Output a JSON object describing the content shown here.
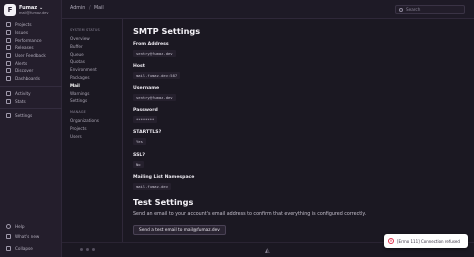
{
  "sidebar": {
    "org_initial": "F",
    "org_name": "Fumaz",
    "org_email": "mail@fumaz.dev",
    "items": [
      {
        "label": "Projects",
        "icon": "projects-icon"
      },
      {
        "label": "Issues",
        "icon": "issues-icon"
      },
      {
        "label": "Performance",
        "icon": "performance-icon"
      },
      {
        "label": "Releases",
        "icon": "releases-icon"
      },
      {
        "label": "User Feedback",
        "icon": "feedback-icon"
      },
      {
        "label": "Alerts",
        "icon": "alerts-icon"
      },
      {
        "label": "Discover",
        "icon": "discover-icon"
      },
      {
        "label": "Dashboards",
        "icon": "dashboards-icon"
      },
      {
        "label": "Activity",
        "icon": "activity-icon"
      },
      {
        "label": "Stats",
        "icon": "stats-icon"
      },
      {
        "label": "Settings",
        "icon": "settings-icon"
      }
    ],
    "help": "Help",
    "whats_new": "What's new",
    "collapse": "Collapse"
  },
  "topbar": {
    "crumb_admin": "Admin",
    "crumb_mail": "Mail",
    "search_placeholder": "Search"
  },
  "subnav": {
    "system_status": "SYSTEM STATUS",
    "system_items": [
      "Overview",
      "Buffer",
      "Queue",
      "Quotas",
      "Environment",
      "Packages",
      "Mail",
      "Warnings",
      "Settings"
    ],
    "manage": "MANAGE",
    "manage_items": [
      "Organizations",
      "Projects",
      "Users"
    ],
    "active": "Mail"
  },
  "smtp": {
    "title": "SMTP Settings",
    "fields": [
      {
        "label": "From Address",
        "value": "sentry@fumaz.dev"
      },
      {
        "label": "Host",
        "value": "mail.fumaz.dev:587"
      },
      {
        "label": "Username",
        "value": "sentry@fumaz.dev"
      },
      {
        "label": "Password",
        "value": "********"
      },
      {
        "label": "STARTTLS?",
        "value": "Yes"
      },
      {
        "label": "SSL?",
        "value": "No"
      },
      {
        "label": "Mailing List Namespace",
        "value": "mail.fumaz.dev"
      }
    ]
  },
  "test": {
    "title": "Test Settings",
    "description": "Send an email to your account's email address to confirm that everything is configured correctly.",
    "button": "Send a test email to mail@fumaz.dev"
  },
  "toast": {
    "text": "[Errno 111] Connection refused",
    "icon": "close-circle-icon"
  }
}
